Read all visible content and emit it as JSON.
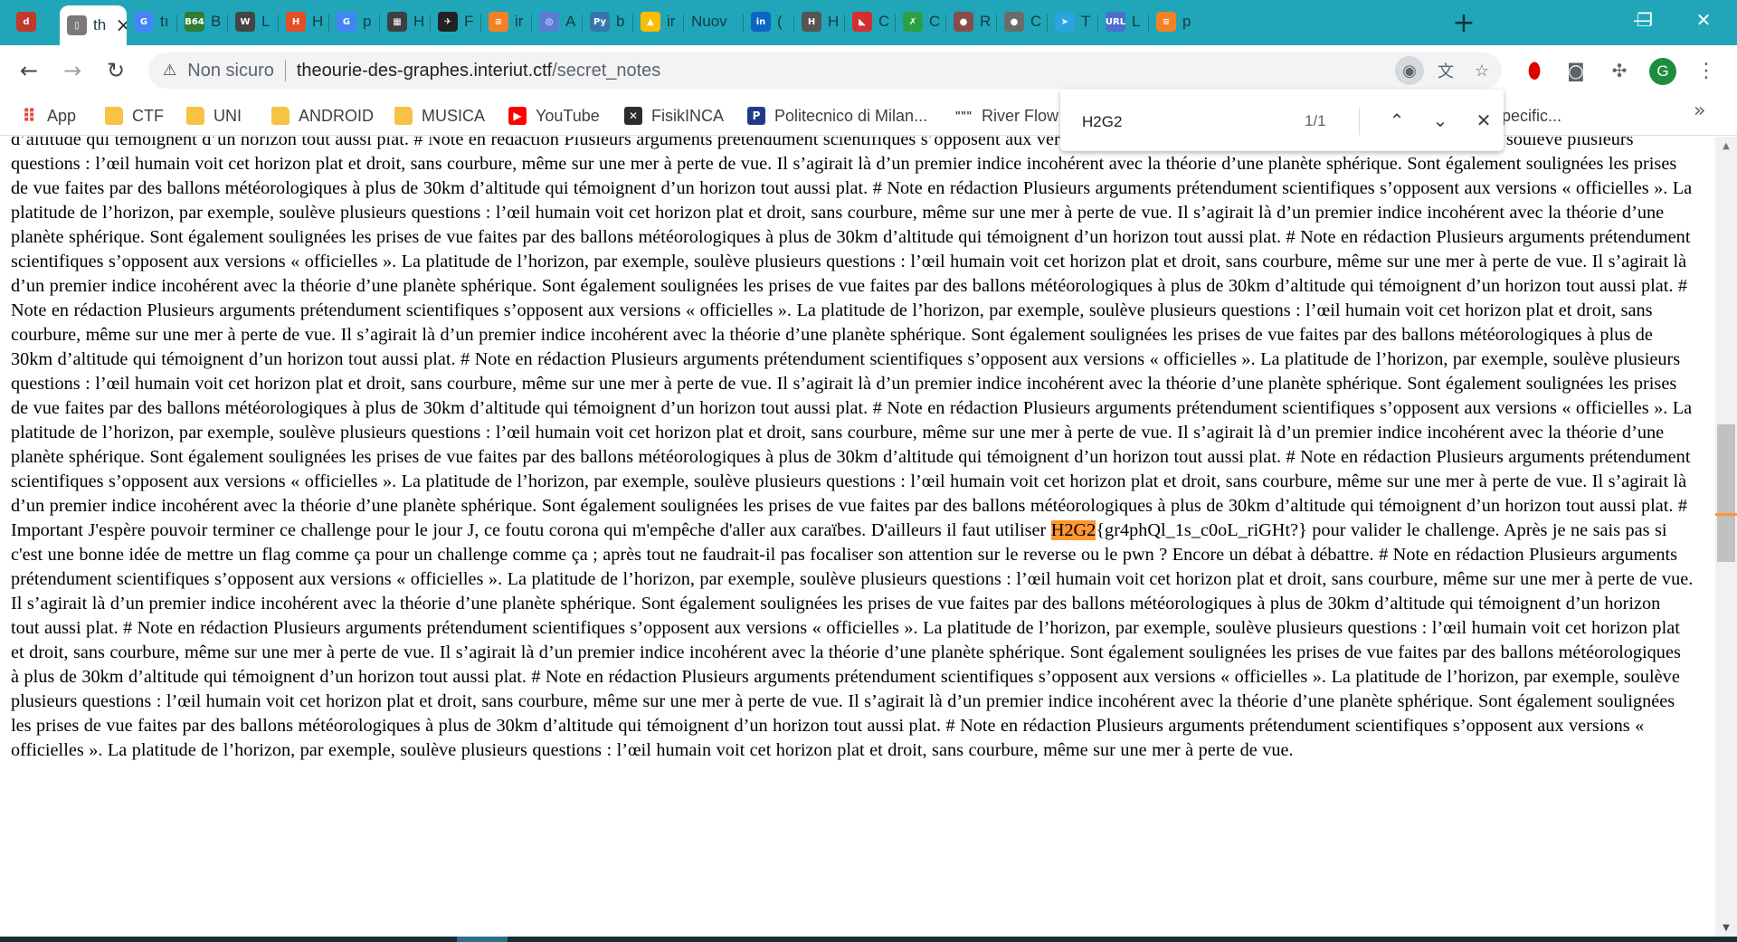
{
  "browser": {
    "tabs": [
      {
        "title": "",
        "favicon": "red-app-icon",
        "color": "#c0392b",
        "glyph": "d"
      },
      {
        "title": "th",
        "favicon": "mobile-icon",
        "color": "#7a7a7a",
        "glyph": "▯",
        "active": true
      },
      {
        "title": "tı",
        "favicon": "google-icon",
        "color": "#4285f4",
        "glyph": "G"
      },
      {
        "title": "B",
        "favicon": "b64-icon",
        "color": "#2e7d32",
        "glyph": "B64"
      },
      {
        "title": "L",
        "favicon": "wikipedia-icon",
        "color": "#444444",
        "glyph": "W"
      },
      {
        "title": "H",
        "favicon": "html5-icon",
        "color": "#e44d26",
        "glyph": "H"
      },
      {
        "title": "p",
        "favicon": "google-icon",
        "color": "#4285f4",
        "glyph": "G"
      },
      {
        "title": "H",
        "favicon": "calculator-icon",
        "color": "#3c4043",
        "glyph": "▦"
      },
      {
        "title": "F",
        "favicon": "compass-icon",
        "color": "#222222",
        "glyph": "✈"
      },
      {
        "title": "ir",
        "favicon": "stack-icon",
        "color": "#f48024",
        "glyph": "≡"
      },
      {
        "title": "A",
        "favicon": "chip-icon",
        "color": "#5b7bd5",
        "glyph": "◎"
      },
      {
        "title": "b",
        "favicon": "python-icon",
        "color": "#3776ab",
        "glyph": "Py"
      },
      {
        "title": "ir",
        "favicon": "drive-icon",
        "color": "#fbbc04",
        "glyph": "▲"
      },
      {
        "title": "Nuov",
        "favicon": "",
        "color": "",
        "glyph": ""
      },
      {
        "title": "(",
        "favicon": "linkedin-icon",
        "color": "#0a66c2",
        "glyph": "in"
      },
      {
        "title": "H",
        "favicon": "h-icon",
        "color": "#555555",
        "glyph": "H"
      },
      {
        "title": "C",
        "favicon": "flag-icon",
        "color": "#d32f2f",
        "glyph": "◣"
      },
      {
        "title": "C",
        "favicon": "runner-icon",
        "color": "#2e9e44",
        "glyph": "✗"
      },
      {
        "title": "R",
        "favicon": "globe-icon",
        "color": "#8a4b4b",
        "glyph": "●"
      },
      {
        "title": "C",
        "favicon": "globe-icon",
        "color": "#6b6b6b",
        "glyph": "●"
      },
      {
        "title": "T",
        "favicon": "telegram-icon",
        "color": "#2aa3df",
        "glyph": "➤"
      },
      {
        "title": "L",
        "favicon": "url-icon",
        "color": "#4a6fd1",
        "glyph": "URL"
      },
      {
        "title": "p",
        "favicon": "stack-icon",
        "color": "#f48024",
        "glyph": "≡"
      }
    ],
    "new_tab_label": "+",
    "window_controls": {
      "minimize": "—",
      "restore": "❐",
      "close": "✕"
    },
    "nav": {
      "back": "←",
      "forward": "→",
      "reload": "↻"
    },
    "omnibox": {
      "security_label": "Non sicuro",
      "url_host": "theourie-des-graphes.interiut.ctf",
      "url_path": "/secret_notes"
    },
    "profile_initial": "G",
    "bookmarks": [
      {
        "label": "App",
        "icon": "apps-grid-icon"
      },
      {
        "label": "CTF",
        "icon": "folder-icon"
      },
      {
        "label": "UNI",
        "icon": "folder-icon"
      },
      {
        "label": "ANDROID",
        "icon": "folder-icon"
      },
      {
        "label": "MUSICA",
        "icon": "folder-icon"
      },
      {
        "label": "YouTube",
        "icon": "youtube-icon"
      },
      {
        "label": "FisikINCA",
        "icon": "fisikinca-icon"
      },
      {
        "label": "Politecnico di Milan...",
        "icon": "polimi-icon"
      },
      {
        "label": "River Flow",
        "icon": "quote-icon"
      }
    ],
    "bookmarks_overflow_text": "pecific...",
    "bookmarks_more": "»"
  },
  "find_bar": {
    "query": "H2G2",
    "count": "1/1"
  },
  "page": {
    "before_match": "d’altitude qui témoignent d’un horizon tout aussi plat. # Note en rédaction Plusieurs arguments prétendument scientifiques s’opposent aux versions « officielles ». La platitude de l’horizon, par exemple, soulève plusieurs questions : l’œil humain voit cet horizon plat et droit, sans courbure, même sur une mer à perte de vue. Il s’agirait là d’un premier indice incohérent avec la théorie d’une planète sphérique. Sont également soulignées les prises de vue faites par des ballons météorologiques à plus de 30km d’altitude qui témoignent d’un horizon tout aussi plat. # Note en rédaction Plusieurs arguments prétendument scientifiques s’opposent aux versions « officielles ». La platitude de l’horizon, par exemple, soulève plusieurs questions : l’œil humain voit cet horizon plat et droit, sans courbure, même sur une mer à perte de vue. Il s’agirait là d’un premier indice incohérent avec la théorie d’une planète sphérique. Sont également soulignées les prises de vue faites par des ballons météorologiques à plus de 30km d’altitude qui témoignent d’un horizon tout aussi plat. # Note en rédaction Plusieurs arguments prétendument scientifiques s’opposent aux versions « officielles ». La platitude de l’horizon, par exemple, soulève plusieurs questions : l’œil humain voit cet horizon plat et droit, sans courbure, même sur une mer à perte de vue. Il s’agirait là d’un premier indice incohérent avec la théorie d’une planète sphérique. Sont également soulignées les prises de vue faites par des ballons météorologiques à plus de 30km d’altitude qui témoignent d’un horizon tout aussi plat. # Note en rédaction Plusieurs arguments prétendument scientifiques s’opposent aux versions « officielles ». La platitude de l’horizon, par exemple, soulève plusieurs questions : l’œil humain voit cet horizon plat et droit, sans courbure, même sur une mer à perte de vue. Il s’agirait là d’un premier indice incohérent avec la théorie d’une planète sphérique. Sont également soulignées les prises de vue faites par des ballons météorologiques à plus de 30km d’altitude qui témoignent d’un horizon tout aussi plat. # Note en rédaction Plusieurs arguments prétendument scientifiques s’opposent aux versions « officielles ». La platitude de l’horizon, par exemple, soulève plusieurs questions : l’œil humain voit cet horizon plat et droit, sans courbure, même sur une mer à perte de vue. Il s’agirait là d’un premier indice incohérent avec la théorie d’une planète sphérique. Sont également soulignées les prises de vue faites par des ballons météorologiques à plus de 30km d’altitude qui témoignent d’un horizon tout aussi plat. # Note en rédaction Plusieurs arguments prétendument scientifiques s’opposent aux versions « officielles ». La platitude de l’horizon, par exemple, soulève plusieurs questions : l’œil humain voit cet horizon plat et droit, sans courbure, même sur une mer à perte de vue. Il s’agirait là d’un premier indice incohérent avec la théorie d’une planète sphérique. Sont également soulignées les prises de vue faites par des ballons météorologiques à plus de 30km d’altitude qui témoignent d’un horizon tout aussi plat. # Note en rédaction Plusieurs arguments prétendument scientifiques s’opposent aux versions « officielles ». La platitude de l’horizon, par exemple, soulève plusieurs questions : l’œil humain voit cet horizon plat et droit, sans courbure, même sur une mer à perte de vue. Il s’agirait là d’un premier indice incohérent avec la théorie d’une planète sphérique. Sont également soulignées les prises de vue faites par des ballons météorologiques à plus de 30km d’altitude qui témoignent d’un horizon tout aussi plat. # Important J'espère pouvoir terminer ce challenge pour le jour J, ce foutu corona qui m'empêche d'aller aux caraïbes. D'ailleurs il faut utiliser ",
    "match": "H2G2",
    "after_match": "{gr4phQl_1s_c0oL_riGHt?} pour valider le challenge. Après je ne sais pas si c'est une bonne idée de mettre un flag comme ça pour un challenge comme ça ; après tout ne faudrait-il pas focaliser son attention sur le reverse ou le pwn ? Encore un débat à débattre. # Note en rédaction Plusieurs arguments prétendument scientifiques s’opposent aux versions « officielles ». La platitude de l’horizon, par exemple, soulève plusieurs questions : l’œil humain voit cet horizon plat et droit, sans courbure, même sur une mer à perte de vue. Il s’agirait là d’un premier indice incohérent avec la théorie d’une planète sphérique. Sont également soulignées les prises de vue faites par des ballons météorologiques à plus de 30km d’altitude qui témoignent d’un horizon tout aussi plat. # Note en rédaction Plusieurs arguments prétendument scientifiques s’opposent aux versions « officielles ». La platitude de l’horizon, par exemple, soulève plusieurs questions : l’œil humain voit cet horizon plat et droit, sans courbure, même sur une mer à perte de vue. Il s’agirait là d’un premier indice incohérent avec la théorie d’une planète sphérique. Sont également soulignées les prises de vue faites par des ballons météorologiques à plus de 30km d’altitude qui témoignent d’un horizon tout aussi plat. # Note en rédaction Plusieurs arguments prétendument scientifiques s’opposent aux versions « officielles ». La platitude de l’horizon, par exemple, soulève plusieurs questions : l’œil humain voit cet horizon plat et droit, sans courbure, même sur une mer à perte de vue. Il s’agirait là d’un premier indice incohérent avec la théorie d’une planète sphérique. Sont également soulignées les prises de vue faites par des ballons météorologiques à plus de 30km d’altitude qui témoignent d’un horizon tout aussi plat. # Note en rédaction Plusieurs arguments prétendument scientifiques s’opposent aux versions « officielles ». La platitude de l’horizon, par exemple, soulève plusieurs questions : l’œil humain voit cet horizon plat et droit, sans courbure, même sur une mer à perte de vue."
  },
  "colors": {
    "tab_strip": "#21a6b9",
    "find_highlight": "#ff9632"
  }
}
